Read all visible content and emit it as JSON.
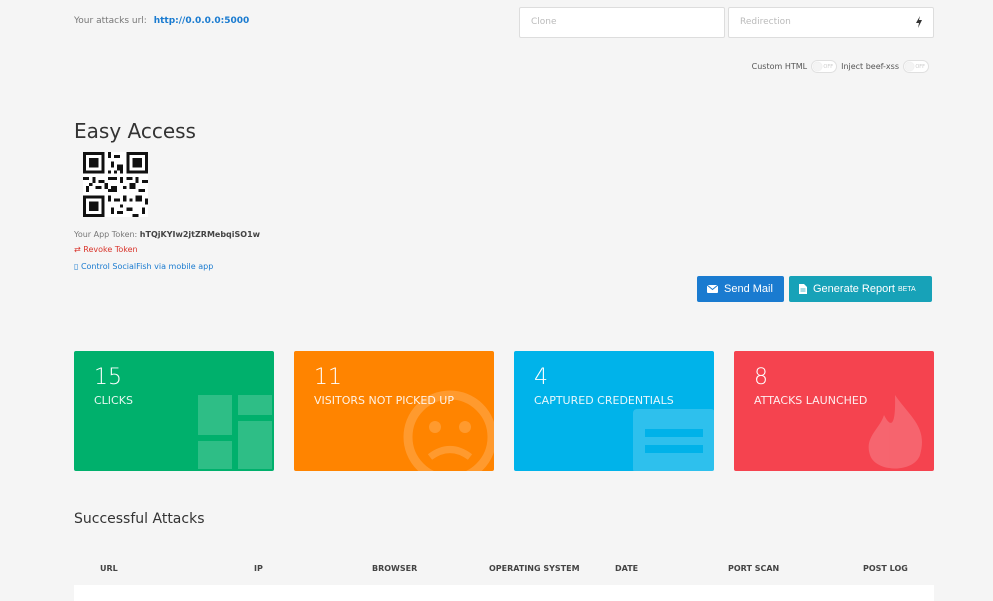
{
  "topbar": {
    "label": "Your attacks url:",
    "url": "http://0.0.0.0:5000"
  },
  "inputs": {
    "clone_placeholder": "Clone",
    "redirection_placeholder": "Redirection"
  },
  "toggles": {
    "custom_html": "Custom HTML",
    "inject_beef": "Inject beef-xss",
    "off": "OFF"
  },
  "easy_access": {
    "title": "Easy Access",
    "token_label": "Your App Token:",
    "token": "hTQjKYIw2jtZRMebqiSO1w",
    "revoke": "Revoke Token",
    "mobile": "Control SocialFish via mobile app"
  },
  "buttons": {
    "send_mail": "Send Mail",
    "generate_report": "Generate Report",
    "beta": "BETA"
  },
  "stats": [
    {
      "value": "15",
      "label": "CLICKS",
      "color": "#00b06c",
      "icon": "dashboard-icon"
    },
    {
      "value": "11",
      "label": "VISITORS NOT PICKED UP",
      "color": "#ff8400",
      "icon": "frown-icon"
    },
    {
      "value": "4",
      "label": "CAPTURED CREDENTIALS",
      "color": "#00b3ea",
      "icon": "card-icon"
    },
    {
      "value": "8",
      "label": "ATTACKS LAUNCHED",
      "color": "#f5434f",
      "icon": "fire-icon"
    }
  ],
  "attacks": {
    "title": "Successful Attacks",
    "columns": [
      "URL",
      "IP",
      "BROWSER",
      "OPERATING SYSTEM",
      "DATE",
      "PORT SCAN",
      "POST LOG"
    ]
  }
}
